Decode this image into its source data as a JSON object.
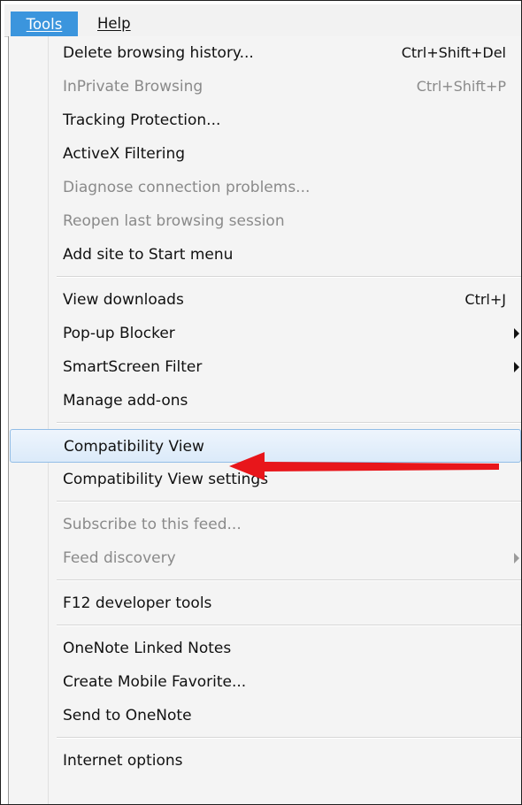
{
  "menubar": {
    "tools_label": "Tools",
    "help_label": "Help"
  },
  "menu": {
    "groups": [
      [
        {
          "label": "Delete browsing history...",
          "shortcut": "Ctrl+Shift+Del",
          "enabled": true
        },
        {
          "label": "InPrivate Browsing",
          "shortcut": "Ctrl+Shift+P",
          "enabled": false
        },
        {
          "label": "Tracking Protection...",
          "shortcut": "",
          "enabled": true
        },
        {
          "label": "ActiveX Filtering",
          "shortcut": "",
          "enabled": true
        },
        {
          "label": "Diagnose connection problems...",
          "shortcut": "",
          "enabled": false
        },
        {
          "label": "Reopen last browsing session",
          "shortcut": "",
          "enabled": false
        },
        {
          "label": "Add site to Start menu",
          "shortcut": "",
          "enabled": true
        }
      ],
      [
        {
          "label": "View downloads",
          "shortcut": "Ctrl+J",
          "enabled": true
        },
        {
          "label": "Pop-up Blocker",
          "shortcut": "",
          "enabled": true,
          "submenu": true
        },
        {
          "label": "SmartScreen Filter",
          "shortcut": "",
          "enabled": true,
          "submenu": true
        },
        {
          "label": "Manage add-ons",
          "shortcut": "",
          "enabled": true
        }
      ],
      [
        {
          "label": "Compatibility View",
          "shortcut": "",
          "enabled": true,
          "highlighted": true
        },
        {
          "label": "Compatibility View settings",
          "shortcut": "",
          "enabled": true
        }
      ],
      [
        {
          "label": "Subscribe to this feed...",
          "shortcut": "",
          "enabled": false
        },
        {
          "label": "Feed discovery",
          "shortcut": "",
          "enabled": false,
          "submenu": true
        }
      ],
      [
        {
          "label": "F12 developer tools",
          "shortcut": "",
          "enabled": true
        }
      ],
      [
        {
          "label": "OneNote Linked Notes",
          "shortcut": "",
          "enabled": true
        },
        {
          "label": "Create Mobile Favorite...",
          "shortcut": "",
          "enabled": true
        },
        {
          "label": "Send to OneNote",
          "shortcut": "",
          "enabled": true
        }
      ],
      [
        {
          "label": "Internet options",
          "shortcut": "",
          "enabled": true
        }
      ]
    ]
  },
  "colors": {
    "menubar_active": "#3b95dd",
    "highlight_border": "#92bde6",
    "disabled_text": "#8a8a8a",
    "annotation_arrow": "#e8161b"
  },
  "annotation": {
    "icon": "red-arrow-icon"
  }
}
